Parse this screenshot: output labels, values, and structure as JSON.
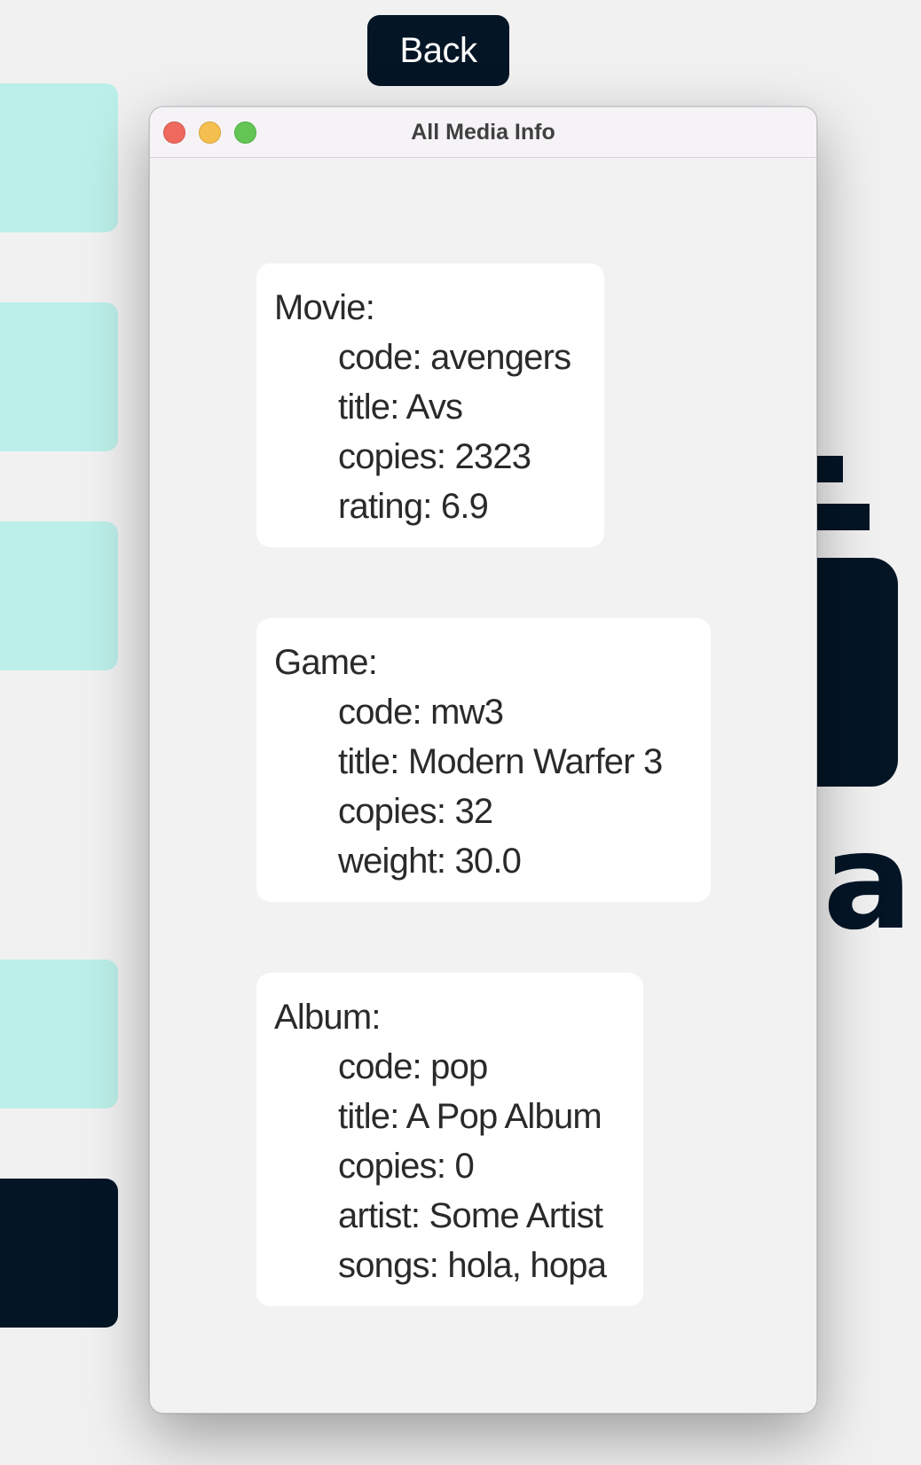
{
  "back_button": {
    "label": "Back"
  },
  "window": {
    "title": "All Media Info"
  },
  "background": {
    "decor_text": "ia"
  },
  "media": [
    {
      "heading": "Movie:",
      "lines": [
        "code: avengers",
        "title: Avs",
        "copies: 2323",
        "rating: 6.9"
      ]
    },
    {
      "heading": "Game:",
      "lines": [
        "code: mw3",
        "title: Modern Warfer 3",
        "copies: 32",
        "weight: 30.0"
      ]
    },
    {
      "heading": "Album:",
      "lines": [
        "code: pop",
        "title: A Pop Album",
        "copies: 0",
        "artist: Some Artist",
        "songs: hola, hopa"
      ]
    }
  ],
  "colors": {
    "background": "#f1f1f2",
    "tile_accent": "#bcefe9",
    "dark": "#041526",
    "card": "#ffffff",
    "traffic_close": "#ee6a5e",
    "traffic_minimize": "#f5bf4f",
    "traffic_zoom": "#62c554"
  }
}
